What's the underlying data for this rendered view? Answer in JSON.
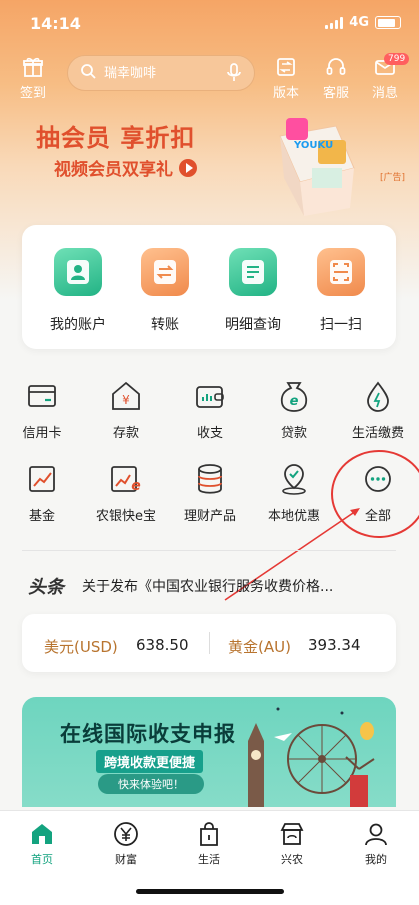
{
  "status": {
    "time": "14:14",
    "network": "4G"
  },
  "header": {
    "signin_label": "签到",
    "search_placeholder": "瑞幸咖啡",
    "version_label": "版本",
    "service_label": "客服",
    "message_label": "消息",
    "message_badge": "799"
  },
  "banner": {
    "title": "抽会员 享折扣",
    "subtitle": "视频会员双享礼",
    "ad_tag": "[广告]",
    "logo_text": "YOUKU"
  },
  "quick_actions": [
    {
      "label": "我的账户",
      "icon": "account-icon",
      "color": "#2fbf8f"
    },
    {
      "label": "转账",
      "icon": "transfer-icon",
      "color": "#f39a5a"
    },
    {
      "label": "明细查询",
      "icon": "detail-icon",
      "color": "#2fbf8f"
    },
    {
      "label": "扫一扫",
      "icon": "scan-icon",
      "color": "#f39a5a"
    }
  ],
  "services": [
    {
      "label": "信用卡",
      "icon": "credit-card-icon"
    },
    {
      "label": "存款",
      "icon": "deposit-icon"
    },
    {
      "label": "收支",
      "icon": "wallet-icon"
    },
    {
      "label": "贷款",
      "icon": "loan-icon"
    },
    {
      "label": "生活缴费",
      "icon": "utility-icon"
    },
    {
      "label": "基金",
      "icon": "fund-icon"
    },
    {
      "label": "农银快e宝",
      "icon": "e-bao-icon"
    },
    {
      "label": "理财产品",
      "icon": "wealth-product-icon"
    },
    {
      "label": "本地优惠",
      "icon": "location-icon"
    },
    {
      "label": "全部",
      "icon": "more-icon"
    }
  ],
  "news": {
    "tag": "头条",
    "text": "关于发布《中国农业银行服务收费价格..."
  },
  "rates": [
    {
      "label": "美元(USD)",
      "value": "638.50"
    },
    {
      "label": "黄金(AU)",
      "value": "393.34"
    }
  ],
  "cross_border": {
    "title": "在线国际收支申报",
    "subtitle": "跨境收款更便捷",
    "button": "快来体验吧！"
  },
  "tabs": [
    {
      "label": "首页",
      "icon": "home-icon",
      "active": true
    },
    {
      "label": "财富",
      "icon": "yen-icon",
      "active": false
    },
    {
      "label": "生活",
      "icon": "bag-icon",
      "active": false
    },
    {
      "label": "兴农",
      "icon": "shop-icon",
      "active": false
    },
    {
      "label": "我的",
      "icon": "user-icon",
      "active": false
    }
  ],
  "colors": {
    "brand_green": "#13a37f",
    "accent_orange": "#f39a5a",
    "promo_red": "#e0502d"
  }
}
